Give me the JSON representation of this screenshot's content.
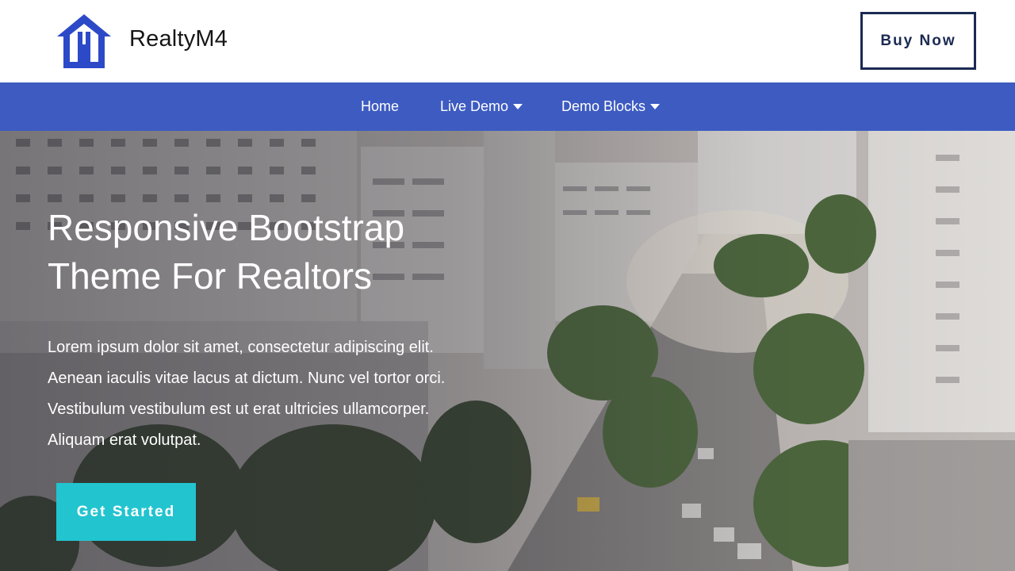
{
  "brand": {
    "name": "RealtyM4",
    "logo_icon": "house-icon",
    "logo_color": "#2c4ac8"
  },
  "header": {
    "buy_label": "Buy Now"
  },
  "nav": {
    "background": "#3d5bc1",
    "items": [
      {
        "label": "Home",
        "dropdown": false
      },
      {
        "label": "Live Demo",
        "dropdown": true
      },
      {
        "label": "Demo Blocks",
        "dropdown": true
      }
    ]
  },
  "hero": {
    "title_line1": "Responsive Bootstrap",
    "title_line2": "Theme For Realtors",
    "text_lines": [
      "Lorem ipsum dolor sit amet, consectetur adipiscing elit.",
      "Aenean iaculis vitae lacus at dictum. Nunc vel tortor orci.",
      "Vestibulum vestibulum est ut erat ultricies ullamcorper.",
      "Aliquam erat volutpat."
    ],
    "cta_label": "Get Started",
    "cta_color": "#22c4cf"
  }
}
